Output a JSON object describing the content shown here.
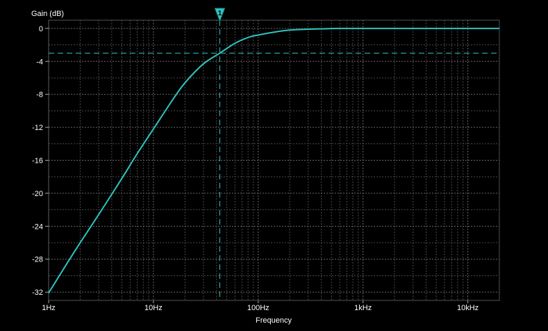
{
  "chart_data": {
    "type": "line",
    "title": "",
    "xlabel": "Frequency",
    "ylabel": "Gain (dB)",
    "x_scale": "log",
    "xlim": [
      1,
      20000
    ],
    "ylim": [
      -33,
      1
    ],
    "grid": true,
    "x_ticks": [
      {
        "value": 1,
        "label": "1Hz"
      },
      {
        "value": 10,
        "label": "10Hz"
      },
      {
        "value": 100,
        "label": "100Hz"
      },
      {
        "value": 1000,
        "label": "1kHz"
      },
      {
        "value": 10000,
        "label": "10kHz"
      }
    ],
    "y_ticks": [
      {
        "value": 0,
        "label": "0"
      },
      {
        "value": -4,
        "label": "-4"
      },
      {
        "value": -8,
        "label": "-8"
      },
      {
        "value": -12,
        "label": "-12"
      },
      {
        "value": -16,
        "label": "-16"
      },
      {
        "value": -20,
        "label": "-20"
      },
      {
        "value": -24,
        "label": "-24"
      },
      {
        "value": -28,
        "label": "-28"
      },
      {
        "value": -32,
        "label": "-32"
      }
    ],
    "series": [
      {
        "color": "#2ec4c0",
        "x": [
          1,
          1.5,
          2,
          3,
          5,
          7,
          10,
          15,
          20,
          30,
          43,
          60,
          80,
          100,
          150,
          200,
          300,
          400,
          600,
          1000,
          2000,
          5000,
          10000,
          20000
        ],
        "y": [
          -32.1,
          -28.5,
          -26.0,
          -22.6,
          -18.2,
          -15.2,
          -12.2,
          -8.8,
          -6.6,
          -4.3,
          -3.0,
          -1.8,
          -1.1,
          -0.8,
          -0.4,
          -0.2,
          -0.1,
          -0.05,
          0,
          0,
          0,
          0,
          0,
          0
        ]
      }
    ],
    "marker": {
      "label": "1",
      "frequency": 43,
      "gain": -3,
      "color": "#2ec4c0"
    }
  }
}
